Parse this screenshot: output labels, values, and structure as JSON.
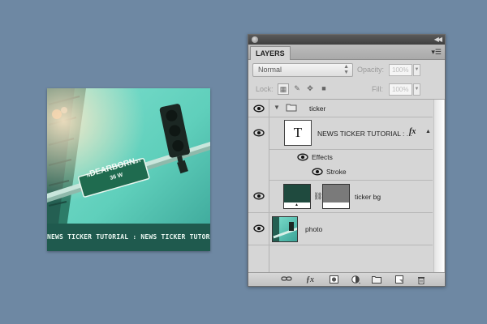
{
  "preview": {
    "sign_street": "DEARBORN",
    "sign_prefix": "N",
    "sign_suffix": "ST",
    "sign_number": "36 W",
    "ticker_text": "NEWS TICKER TUTORIAL  :   NEWS TICKER TUTORIAL  :"
  },
  "panel": {
    "tab_label": "LAYERS",
    "blend_mode": "Normal",
    "opacity_label": "Opacity:",
    "opacity_value": "100%",
    "lock_label": "Lock:",
    "fill_label": "Fill:",
    "fill_value": "100%"
  },
  "layers": [
    {
      "name": "ticker",
      "type": "group"
    },
    {
      "name": "NEWS TICKER TUTORIAL  :  ...",
      "type": "text",
      "thumb_glyph": "T",
      "fx": "fx"
    },
    {
      "name": "Effects",
      "type": "effects"
    },
    {
      "name": "Stroke",
      "type": "effect"
    },
    {
      "name": "ticker bg",
      "type": "shape"
    },
    {
      "name": "photo",
      "type": "image"
    }
  ],
  "bottom_icons": [
    "link-icon",
    "fx-icon",
    "mask-icon",
    "adjustment-icon",
    "folder-icon",
    "new-layer-icon",
    "trash-icon"
  ],
  "colors": {
    "background": "#6e88a3",
    "ticker_band": "#1f5a4e",
    "ticker_bg_thumb": "#1f4a3e",
    "ticker_bg_mask": "#7a7a7a",
    "panel": "#d6d6d6"
  }
}
